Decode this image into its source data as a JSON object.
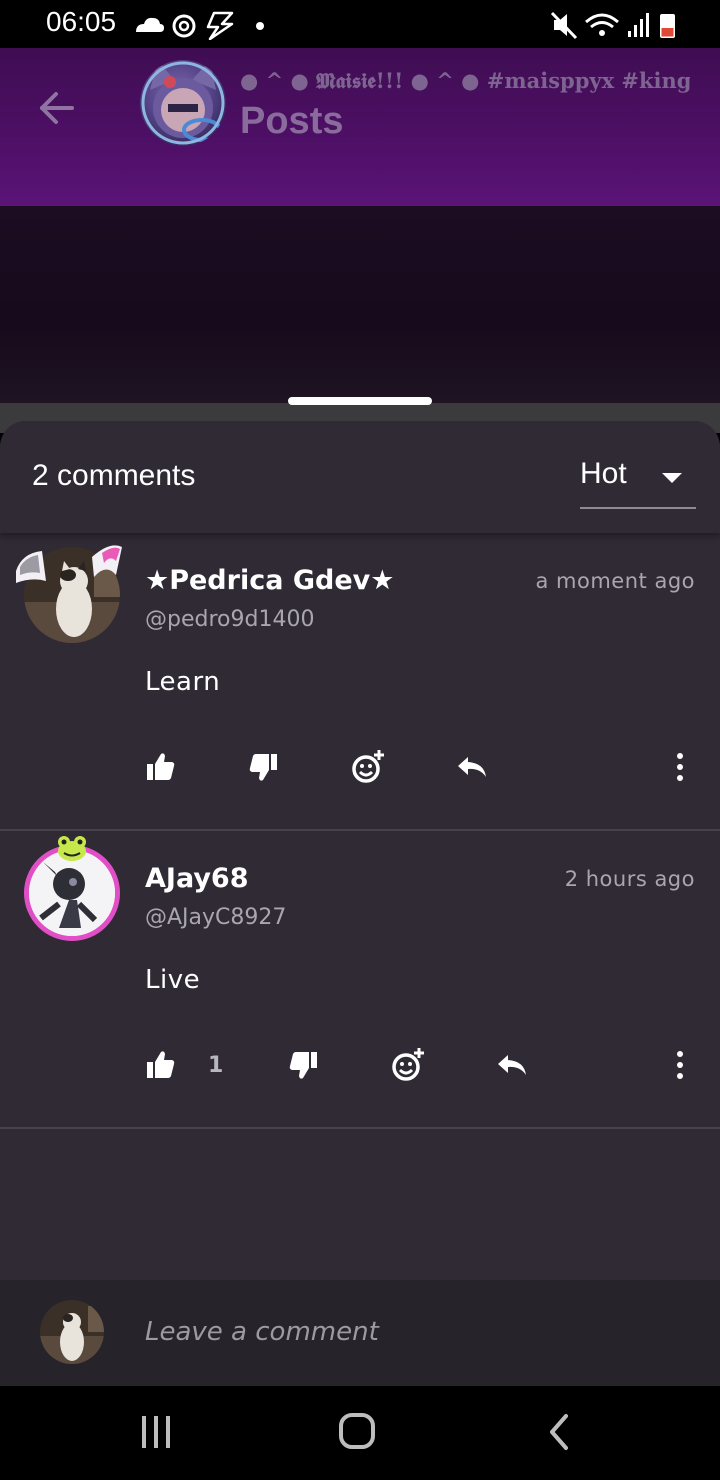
{
  "status_bar": {
    "time": "06:05",
    "left_icons": [
      "cloud-icon",
      "sync-icon",
      "bolt-icon",
      "dot-icon"
    ],
    "right_icons": [
      "mute-icon",
      "wifi-icon",
      "signal-icon",
      "battery-icon"
    ]
  },
  "header": {
    "community_name": "● ^ ● 𝕸𝖆𝖎𝖘𝖎𝖊!!! ● ^ ● #maisppyx #kingsamr",
    "title": "Posts",
    "back_icon": "arrow-left-icon"
  },
  "comments_sheet": {
    "count_label": "2 comments",
    "sort": {
      "selected": "Hot"
    },
    "comments": [
      {
        "author": "★Pedrica Gdev★",
        "handle": "@pedro9d1400",
        "time": "a moment ago",
        "text": "Learn",
        "likes": ""
      },
      {
        "author": "AJay68",
        "handle": "@AJayC8927",
        "time": "2 hours ago",
        "text": "Live",
        "likes": "1"
      }
    ],
    "composer": {
      "placeholder": "Leave a comment"
    }
  },
  "colors": {
    "header_purple": "#4d0f65",
    "sheet_bg": "#2f2a34",
    "secondary_text": "#a9a6ae",
    "avatar_ring_pink": "#e14fc6"
  }
}
